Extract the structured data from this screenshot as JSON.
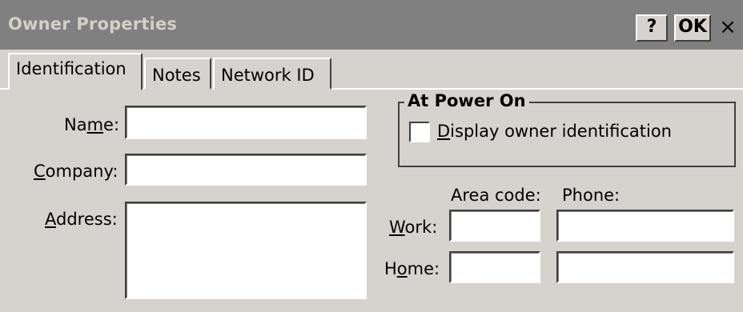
{
  "window": {
    "title": "Owner Properties",
    "help_label": "?",
    "ok_label": "OK",
    "close_label": "×"
  },
  "tabs": [
    {
      "label": "Identification",
      "active": true
    },
    {
      "label": "Notes",
      "active": false
    },
    {
      "label": "Network ID",
      "active": false
    }
  ],
  "form": {
    "name_label_pre": "Na",
    "name_label_u": "m",
    "name_label_post": "e:",
    "name_value": "",
    "company_label_u": "C",
    "company_label_post": "ompany:",
    "company_value": "",
    "address_label_u": "A",
    "address_label_post": "ddress:",
    "address_value": ""
  },
  "power_on": {
    "group_title": "At Power On",
    "checkbox_label_u": "D",
    "checkbox_label_post": "isplay owner identification",
    "checked": false
  },
  "phone": {
    "area_code_header": "Area code:",
    "phone_header": "Phone:",
    "work_label_u": "W",
    "work_label_post": "ork:",
    "work_area": "",
    "work_phone": "",
    "home_label_pre": "H",
    "home_label_u": "o",
    "home_label_post": "me:",
    "home_area": "",
    "home_phone": ""
  }
}
